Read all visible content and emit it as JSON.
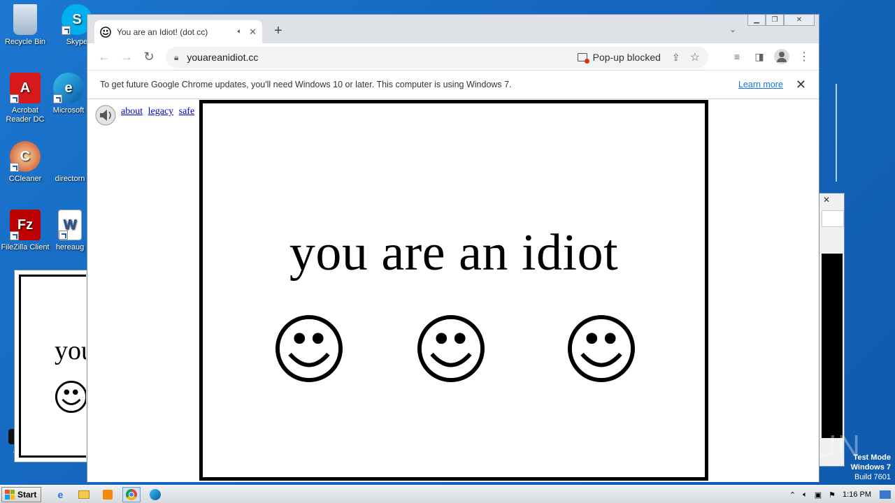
{
  "desktop": {
    "icons": [
      {
        "label": "Recycle Bin"
      },
      {
        "label": "Skype"
      },
      {
        "label": "Acrobat Reader DC"
      },
      {
        "label": "Microsoft"
      },
      {
        "label": "CCleaner"
      },
      {
        "label": "directorn"
      },
      {
        "label": "FileZilla Client"
      },
      {
        "label": "hereaug"
      },
      {
        "label": "ass"
      }
    ],
    "bg_popup_text": "you",
    "watermark": "ANY RUN",
    "test_mode": {
      "line1": "Test Mode",
      "line2": "Windows 7",
      "line3": "Build 7601"
    }
  },
  "browser": {
    "tab": {
      "title": "You are an Idiot! (dot cc)"
    },
    "url": "youareanidiot.cc",
    "popup_blocked": "Pop-up blocked",
    "infobar": {
      "message": "To get future Google Chrome updates, you'll need Windows 10 or later. This computer is using Windows 7.",
      "learn_more": "Learn more"
    }
  },
  "page": {
    "links": [
      "about",
      "legacy",
      "safe"
    ],
    "headline": "you are an idiot",
    "smiley_count": 3
  },
  "taskbar": {
    "start": "Start",
    "clock": "1:16 PM"
  },
  "colors": {
    "desktop": "#1567be",
    "link": "#0000cc",
    "chrome_tabstrip": "#dee1e6"
  }
}
